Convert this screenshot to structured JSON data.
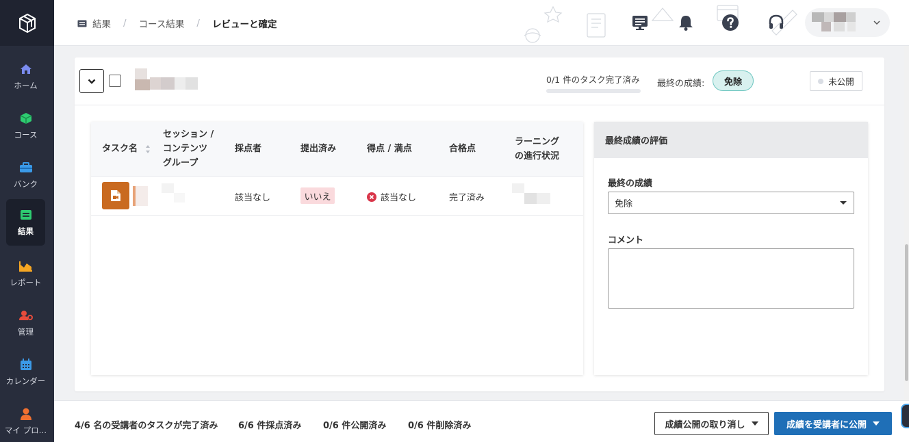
{
  "sidebar": {
    "items": [
      {
        "label": "ホーム",
        "icon": "home-icon",
        "color": "#7b8cf0"
      },
      {
        "label": "コース",
        "icon": "cube-icon",
        "color": "#2ecc71"
      },
      {
        "label": "バンク",
        "icon": "toolbox-icon",
        "color": "#3b9ae8"
      },
      {
        "label": "結果",
        "icon": "results-icon",
        "color": "#2ecc71",
        "active": true
      },
      {
        "label": "レポート",
        "icon": "chart-area-icon",
        "color": "#f5a623"
      },
      {
        "label": "管理",
        "icon": "user-gear-icon",
        "color": "#e74c3c"
      },
      {
        "label": "カレンダー",
        "icon": "calendar-icon",
        "color": "#3b9ae8"
      },
      {
        "label": "マイ プロ…",
        "icon": "person-icon",
        "color": "#f07030"
      }
    ]
  },
  "header": {
    "breadcrumb": [
      "結果",
      "コース結果",
      "レビューと確定"
    ]
  },
  "learner": {
    "progress_text": "0/1 件のタスク完了済み",
    "progress_fraction": 0,
    "final_grade_label": "最終の成績:",
    "final_grade_value": "免除",
    "publish_status": "未公開"
  },
  "task_table": {
    "columns": [
      "タスク名",
      "セッション / コンテンツ グループ",
      "採点者",
      "提出済み",
      "得点 / 満点",
      "合格点",
      "ラーニング の進行状況"
    ],
    "rows": [
      {
        "grader": "該当なし",
        "submitted": "いいえ",
        "score": "該当なし",
        "passing": "完了済み"
      }
    ]
  },
  "grade_panel": {
    "title": "最終成績の評価",
    "grade_label": "最終の成績",
    "grade_value": "免除",
    "comment_label": "コメント"
  },
  "footer": {
    "stats": [
      "4/6 名の受講者のタスクが完了済み",
      "6/6 件採点済み",
      "0/6 件公開済み",
      "0/6 件削除済み"
    ],
    "cancel_button": "成績公開の取り消し",
    "publish_button": "成績を受講者に公開"
  }
}
